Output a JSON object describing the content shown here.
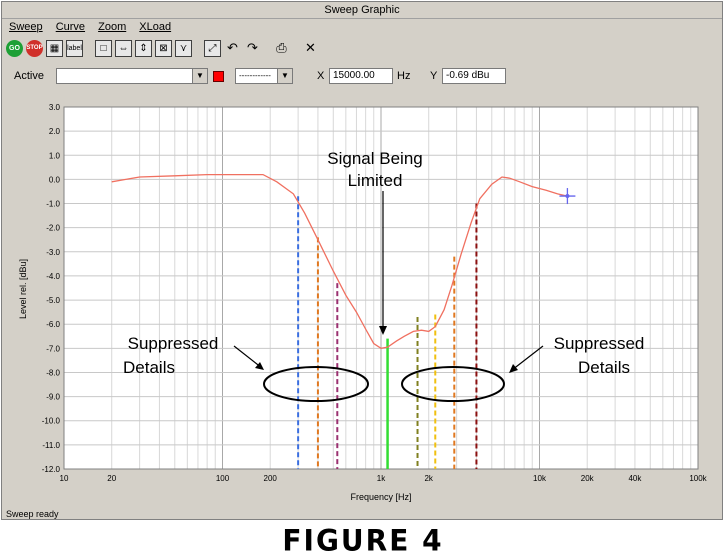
{
  "window": {
    "title": "Sweep Graphic"
  },
  "menu": [
    {
      "label": "Sweep"
    },
    {
      "label": "Curve"
    },
    {
      "label": "Zoom"
    },
    {
      "label": "XLoad"
    }
  ],
  "toolbar": {
    "go_label": "GO",
    "stop_label": "STOP",
    "label_label": "label"
  },
  "controls": {
    "active_label": "Active",
    "active_value": "",
    "line_style_value": "------------",
    "x_label": "X",
    "x_value": "15000.00",
    "x_unit": "Hz",
    "y_label": "Y",
    "y_value": "-0.69 dBu"
  },
  "status": {
    "text": "Sweep ready"
  },
  "caption": {
    "text": "FIGURE 4"
  },
  "annotations": {
    "signal_line1": "Signal Being",
    "signal_line2": "Limited",
    "left_line1": "Suppressed",
    "left_line2": "Details",
    "right_line1": "Suppressed",
    "right_line2": "Details"
  },
  "colors": {
    "curve": "#f07060",
    "signal": "#33dd33",
    "cursor": "#6666ee"
  },
  "chart_data": {
    "type": "line",
    "xlabel": "Frequency [Hz]",
    "ylabel": "Level rel. [dBu]",
    "xscale": "log",
    "xlim": [
      10,
      100000
    ],
    "ylim": [
      -12,
      3
    ],
    "grid": true,
    "x_ticks": [
      {
        "v": 10,
        "label": "10"
      },
      {
        "v": 20,
        "label": "20"
      },
      {
        "v": 100,
        "label": "100"
      },
      {
        "v": 200,
        "label": "200"
      },
      {
        "v": 1000,
        "label": "1k"
      },
      {
        "v": 2000,
        "label": "2k"
      },
      {
        "v": 10000,
        "label": "10k"
      },
      {
        "v": 20000,
        "label": "20k"
      },
      {
        "v": 40000,
        "label": "40k"
      },
      {
        "v": 100000,
        "label": "100k"
      }
    ],
    "y_ticks": [
      "3.0",
      "2.0",
      "1.0",
      "0.0",
      "-1.0",
      "-2.0",
      "-3.0",
      "-4.0",
      "-5.0",
      "-6.0",
      "-7.0",
      "-8.0",
      "-9.0",
      "-10.0",
      "-11.0",
      "-12.0"
    ],
    "series": [
      {
        "x": [
          20,
          30,
          50,
          80,
          130,
          180,
          220,
          280,
          330,
          400,
          500,
          600,
          700,
          800,
          900,
          1000,
          1100,
          1250,
          1400,
          1600,
          1800,
          2000,
          2200,
          2500,
          2800,
          3200,
          3700,
          4200,
          5000,
          5800,
          6500,
          7500,
          9000,
          11000,
          13000,
          15000
        ],
        "y": [
          -0.1,
          0.1,
          0.15,
          0.2,
          0.2,
          0.2,
          -0.1,
          -0.6,
          -1.4,
          -2.5,
          -3.8,
          -4.8,
          -5.5,
          -6.2,
          -6.8,
          -7.0,
          -6.95,
          -6.7,
          -6.5,
          -6.3,
          -6.25,
          -6.3,
          -6.1,
          -5.4,
          -4.4,
          -3.1,
          -1.8,
          -0.8,
          -0.2,
          0.1,
          0.05,
          -0.1,
          -0.3,
          -0.45,
          -0.6,
          -0.69
        ]
      }
    ],
    "markers": [
      {
        "x": 300,
        "ytop": -0.7,
        "color": "#3a6ee0"
      },
      {
        "x": 400,
        "ytop": -2.4,
        "color": "#e07820"
      },
      {
        "x": 530,
        "ytop": -4.3,
        "color": "#9a3070"
      },
      {
        "x": 1100,
        "ytop": -6.6,
        "color": "#33dd33",
        "solid": true
      },
      {
        "x": 1700,
        "ytop": -5.7,
        "color": "#808020"
      },
      {
        "x": 2200,
        "ytop": -5.6,
        "color": "#f0c010"
      },
      {
        "x": 2900,
        "ytop": -3.2,
        "color": "#e07820"
      },
      {
        "x": 4000,
        "ytop": -1.0,
        "color": "#8b1010"
      }
    ],
    "cursor": {
      "x": 15000,
      "y": -0.69
    }
  }
}
